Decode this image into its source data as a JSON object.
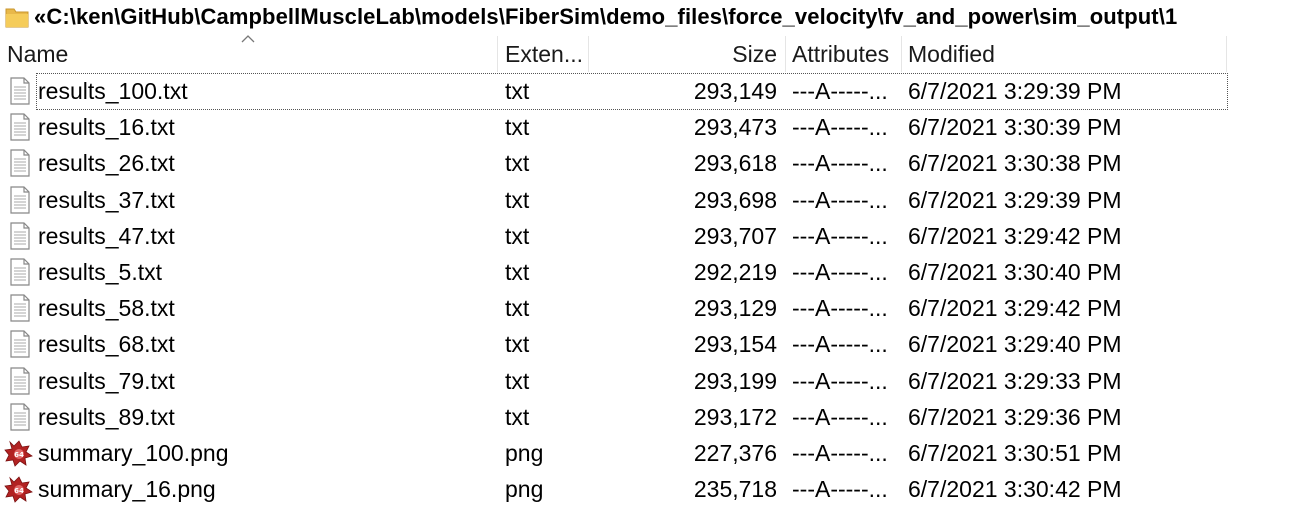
{
  "path": {
    "text": "«C:\\ken\\GitHub\\CampbellMuscleLab\\models\\FiberSim\\demo_files\\force_velocity\\fv_and_power\\sim_output\\1",
    "icon": "folder-icon"
  },
  "columns": {
    "name": "Name",
    "extension": "Exten...",
    "size": "Size",
    "attributes": "Attributes",
    "modified": "Modified"
  },
  "rows": [
    {
      "name": "results_100.txt",
      "ext": "txt",
      "size": "293,149",
      "attr": "---A-----...",
      "modified": "6/7/2021 3:29:39 PM",
      "icon": "text-file-icon",
      "selected": true
    },
    {
      "name": "results_16.txt",
      "ext": "txt",
      "size": "293,473",
      "attr": "---A-----...",
      "modified": "6/7/2021 3:30:39 PM",
      "icon": "text-file-icon"
    },
    {
      "name": "results_26.txt",
      "ext": "txt",
      "size": "293,618",
      "attr": "---A-----...",
      "modified": "6/7/2021 3:30:38 PM",
      "icon": "text-file-icon"
    },
    {
      "name": "results_37.txt",
      "ext": "txt",
      "size": "293,698",
      "attr": "---A-----...",
      "modified": "6/7/2021 3:29:39 PM",
      "icon": "text-file-icon"
    },
    {
      "name": "results_47.txt",
      "ext": "txt",
      "size": "293,707",
      "attr": "---A-----...",
      "modified": "6/7/2021 3:29:42 PM",
      "icon": "text-file-icon"
    },
    {
      "name": "results_5.txt",
      "ext": "txt",
      "size": "292,219",
      "attr": "---A-----...",
      "modified": "6/7/2021 3:30:40 PM",
      "icon": "text-file-icon"
    },
    {
      "name": "results_58.txt",
      "ext": "txt",
      "size": "293,129",
      "attr": "---A-----...",
      "modified": "6/7/2021 3:29:42 PM",
      "icon": "text-file-icon"
    },
    {
      "name": "results_68.txt",
      "ext": "txt",
      "size": "293,154",
      "attr": "---A-----...",
      "modified": "6/7/2021 3:29:40 PM",
      "icon": "text-file-icon"
    },
    {
      "name": "results_79.txt",
      "ext": "txt",
      "size": "293,199",
      "attr": "---A-----...",
      "modified": "6/7/2021 3:29:33 PM",
      "icon": "text-file-icon"
    },
    {
      "name": "results_89.txt",
      "ext": "txt",
      "size": "293,172",
      "attr": "---A-----...",
      "modified": "6/7/2021 3:29:36 PM",
      "icon": "text-file-icon"
    },
    {
      "name": "summary_100.png",
      "ext": "png",
      "size": "227,376",
      "attr": "---A-----...",
      "modified": "6/7/2021 3:30:51 PM",
      "icon": "image-file-icon"
    },
    {
      "name": "summary_16.png",
      "ext": "png",
      "size": "235,718",
      "attr": "---A-----...",
      "modified": "6/7/2021 3:30:42 PM",
      "icon": "image-file-icon"
    }
  ],
  "colors": {
    "folder": "#e8b84a",
    "image_icon": "#b22222",
    "selection_border": "#555555"
  }
}
